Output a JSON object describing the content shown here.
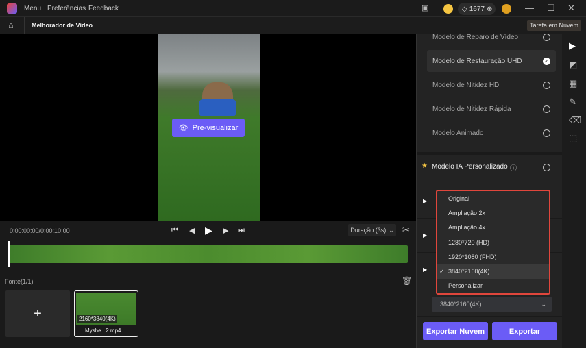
{
  "titlebar": {
    "menu": "Menu",
    "preferences": "Preferências",
    "feedback": "Feedback",
    "credits": "1677"
  },
  "subbar": {
    "title": "Melhorador de Vídeo",
    "cloud_task": "Tarefa em Nuvem"
  },
  "preview": {
    "button": "Pre-visualizar"
  },
  "controls": {
    "time": "0:00:00:00/0:00:10:00",
    "duration": "Duração (3s)"
  },
  "source": {
    "label": "Fonte(1/1)",
    "resolution": "2160*3840(4K)",
    "filename": "Myshe...2.mp4"
  },
  "models": [
    {
      "label": "Modelo de Reparo de Vídeo",
      "selected": false
    },
    {
      "label": "Modelo de Restauração UHD",
      "selected": true
    },
    {
      "label": "Modelo de Nitidez HD",
      "selected": false
    },
    {
      "label": "Modelo de Nitidez Rápida",
      "selected": false
    },
    {
      "label": "Modelo Animado",
      "selected": false
    }
  ],
  "custom_model": {
    "label": "Modelo IA Personalizado"
  },
  "resolution_dropdown": {
    "options": [
      "Original",
      "Ampliação 2x",
      "Ampliação 4x",
      "1280*720 (HD)",
      "1920*1080 (FHD)",
      "3840*2160(4K)",
      "Personalizar"
    ],
    "selected": "3840*2160(4K)"
  },
  "actions": {
    "cloud_export": "Exportar Nuvem",
    "export": "Exportar"
  },
  "colors": {
    "accent": "#6b5cf6",
    "highlight_border": "#e0463c"
  }
}
